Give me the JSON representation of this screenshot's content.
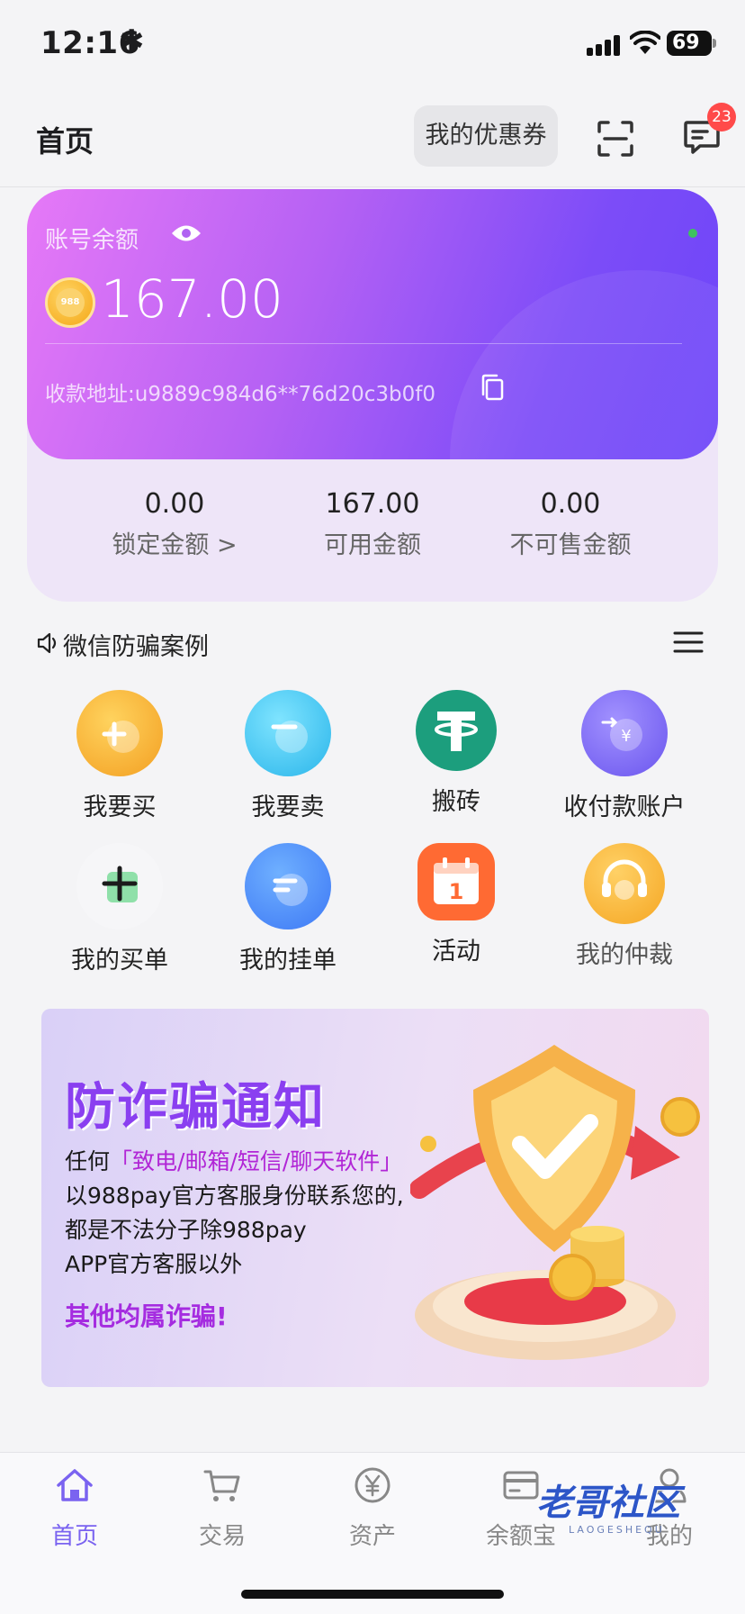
{
  "status_bar": {
    "time": "12:16",
    "star": "✱",
    "battery": "69"
  },
  "header": {
    "title": "首页",
    "coupon_label": "我的优惠券",
    "message_badge": "23"
  },
  "balance": {
    "label": "账号余额",
    "amount": "167.00",
    "address": "收款地址:u9889c984d6**76d20c3b0f0",
    "stats": [
      {
        "value": "0.00",
        "label": "锁定金额 >"
      },
      {
        "value": "167.00",
        "label": "可用金额"
      },
      {
        "value": "0.00",
        "label": "不可售金额"
      }
    ]
  },
  "notice": {
    "text": "微信防骗案例"
  },
  "grid": [
    {
      "label": "我要买",
      "icon": "plus-circle-icon",
      "color": "#f7a92b"
    },
    {
      "label": "我要卖",
      "icon": "minus-circle-icon",
      "color": "#35c1ea"
    },
    {
      "label": "搬砖",
      "icon": "tether-icon",
      "color": "#1c9e7d"
    },
    {
      "label": "收付款账户",
      "icon": "exchange-icon",
      "color": "#7a66f3"
    },
    {
      "label": "我的买单",
      "icon": "buy-order-icon",
      "color": "#2fbf6a"
    },
    {
      "label": "我的挂单",
      "icon": "list-order-icon",
      "color": "#4d86f8"
    },
    {
      "label": "活动",
      "icon": "calendar-icon",
      "color": "#ff6a33"
    },
    {
      "label": "我的仲裁",
      "icon": "support-headset-icon",
      "color": "#f7b22e"
    }
  ],
  "banner": {
    "title": "防诈骗通知",
    "line1_prefix": "任何",
    "line1_highlight": "「致电/邮箱/短信/聊天软件」",
    "line2": "以988pay官方客服身份联系您的,",
    "line3": "都是不法分子除988pay",
    "line4": "APP官方客服以外",
    "line5": "其他均属诈骗!"
  },
  "tabs": [
    {
      "label": "首页",
      "icon": "home-icon",
      "active": true
    },
    {
      "label": "交易",
      "icon": "cart-icon"
    },
    {
      "label": "资产",
      "icon": "yuan-icon"
    },
    {
      "label": "余额宝",
      "icon": "wallet-card-icon"
    },
    {
      "label": "我的",
      "icon": "user-icon"
    }
  ],
  "watermark": {
    "text": "老哥社区",
    "sub": "LAOGESHEQU"
  },
  "colors": {
    "accent": "#7a63f0",
    "card_start": "#e679f7",
    "card_end": "#6d45f9"
  }
}
